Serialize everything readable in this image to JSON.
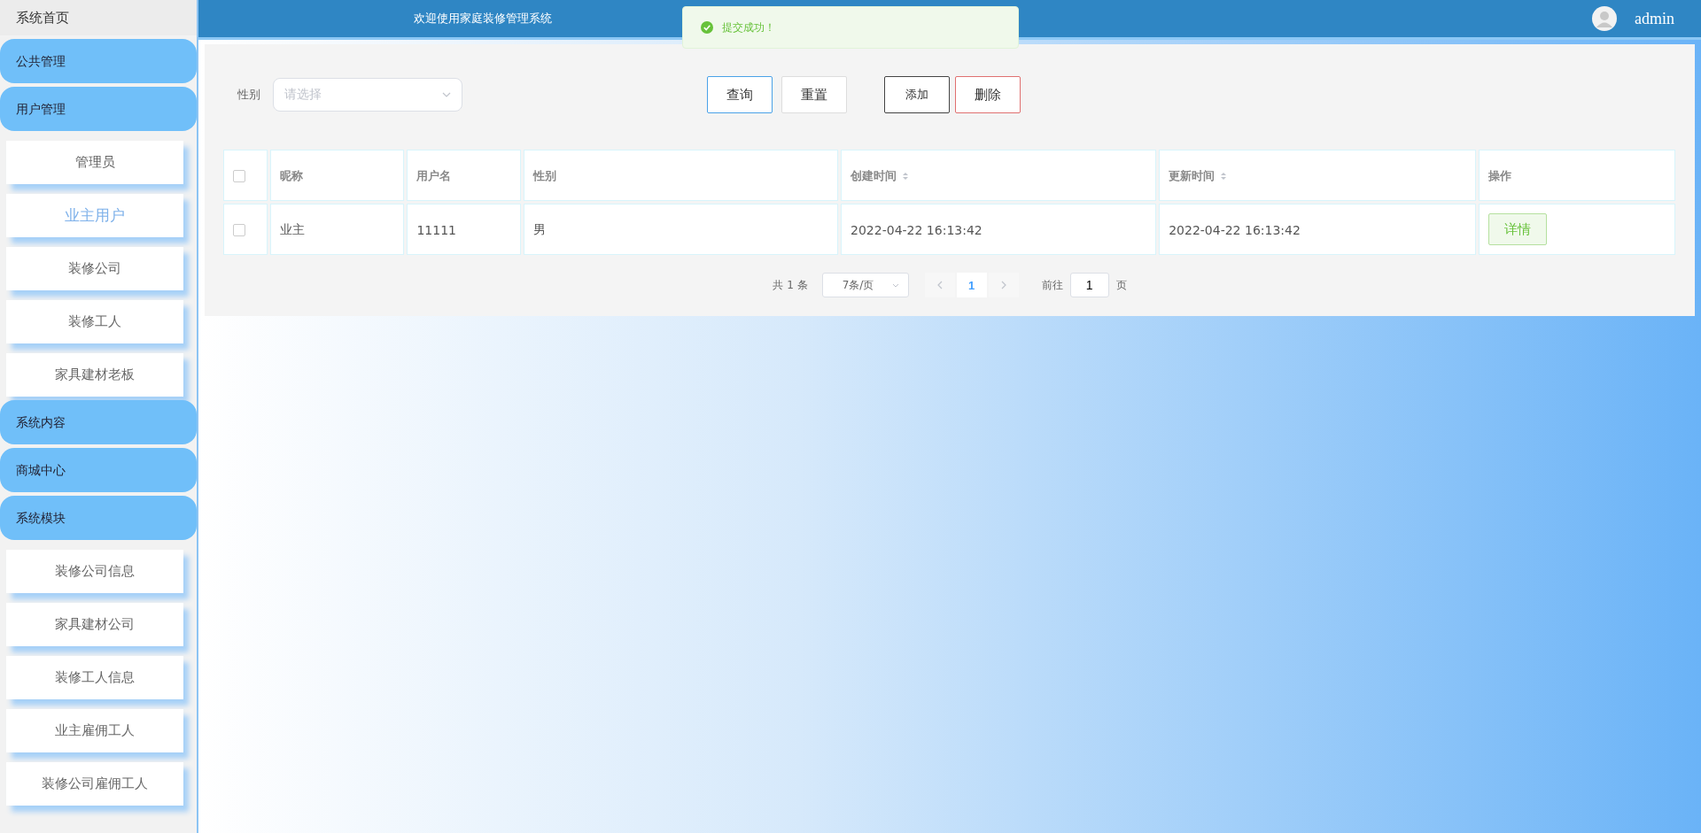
{
  "sidebar": {
    "home": "系统首页",
    "groups": [
      {
        "label": "公共管理"
      },
      {
        "label": "用户管理",
        "children": [
          {
            "label": "管理员",
            "selected": false
          },
          {
            "label": "业主用户",
            "selected": true
          },
          {
            "label": "装修公司",
            "selected": false
          },
          {
            "label": "装修工人",
            "selected": false
          },
          {
            "label": "家具建材老板",
            "selected": false
          }
        ]
      },
      {
        "label": "系统内容"
      },
      {
        "label": "商城中心"
      },
      {
        "label": "系统模块",
        "children": [
          {
            "label": "装修公司信息",
            "selected": false
          },
          {
            "label": "家具建材公司",
            "selected": false
          },
          {
            "label": "装修工人信息",
            "selected": false
          },
          {
            "label": "业主雇佣工人",
            "selected": false
          },
          {
            "label": "装修公司雇佣工人",
            "selected": false
          }
        ]
      }
    ]
  },
  "header": {
    "title": "欢迎使用家庭装修管理系统",
    "user": "admin"
  },
  "toast": {
    "message": "提交成功！"
  },
  "filter": {
    "label": "性别",
    "select": {
      "placeholder": "请选择"
    }
  },
  "buttons": [
    {
      "label": "查询",
      "kind": "search"
    },
    {
      "label": "重置",
      "kind": "reset"
    },
    {
      "label": "添加",
      "kind": "add"
    },
    {
      "label": "删除",
      "kind": "delete"
    }
  ],
  "table": {
    "header_checked": false,
    "columns": [
      {
        "label": "昵称",
        "sortable": false
      },
      {
        "label": "用户名",
        "sortable": false
      },
      {
        "label": "性别",
        "sortable": false
      },
      {
        "label": "创建时间",
        "sortable": true
      },
      {
        "label": "更新时间",
        "sortable": true
      },
      {
        "label": "操作",
        "sortable": false
      }
    ],
    "rows": [
      {
        "checked": false,
        "cells": [
          "业主",
          "11111",
          "男",
          "2022-04-22 16:13:42",
          "2022-04-22 16:13:42"
        ],
        "action": "详情"
      }
    ]
  },
  "pagination": {
    "total": "共 1 条",
    "page_size": "7条/页",
    "pages": [
      {
        "label": "1",
        "selected": true
      }
    ],
    "goto_label": "前往",
    "goto_value": "1",
    "page_suffix": "页"
  }
}
